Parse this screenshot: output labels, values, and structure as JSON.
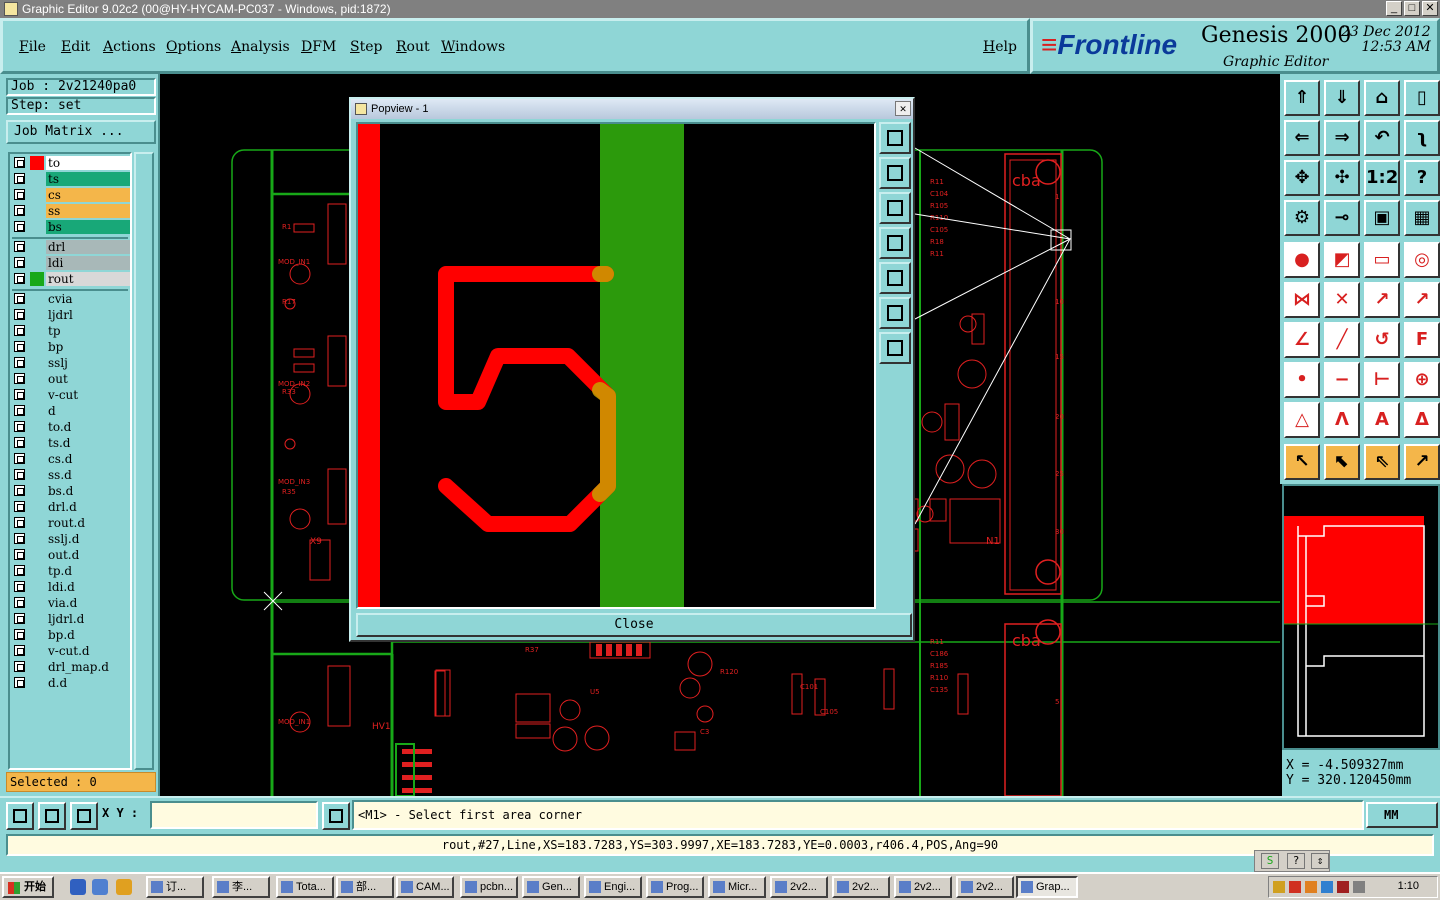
{
  "window": {
    "title": "Graphic Editor 9.02c2 (00@HY-HYCAM-PC037 - Windows, pid:1872)"
  },
  "menu": {
    "items": [
      "File",
      "Edit",
      "Actions",
      "Options",
      "Analysis",
      "DFM",
      "Step",
      "Rout",
      "Windows"
    ],
    "help": "Help"
  },
  "brand": {
    "logo": "Frontline",
    "product": "Genesis 2000",
    "subtitle": "Graphic Editor",
    "date": "23 Dec 2012",
    "time": "12:53 AM"
  },
  "job": {
    "job_label": "Job : 2v21240pa0",
    "step_label": "Step: set",
    "matrix_button": "Job Matrix ..."
  },
  "layers": [
    {
      "name": "to",
      "color": "#ff0000",
      "fill": "#ffffff"
    },
    {
      "name": "ts",
      "color": "",
      "fill": "#18a878"
    },
    {
      "name": "cs",
      "color": "",
      "fill": "#f4b64a"
    },
    {
      "name": "ss",
      "color": "",
      "fill": "#f4b64a"
    },
    {
      "name": "bs",
      "color": "",
      "fill": "#18a878"
    },
    {
      "name": "drl",
      "color": "",
      "fill": "#a8b8b8"
    },
    {
      "name": "ldi",
      "color": "",
      "fill": "#a8b8b8"
    },
    {
      "name": "rout",
      "color": "#18a818",
      "fill": "#d8d8d8"
    },
    {
      "name": "cvia",
      "color": "",
      "fill": "#8fd6d6"
    },
    {
      "name": "ljdrl",
      "color": "",
      "fill": "#8fd6d6"
    },
    {
      "name": "tp",
      "color": "",
      "fill": "#8fd6d6"
    },
    {
      "name": "bp",
      "color": "",
      "fill": "#8fd6d6"
    },
    {
      "name": "sslj",
      "color": "",
      "fill": "#8fd6d6"
    },
    {
      "name": "out",
      "color": "",
      "fill": "#8fd6d6"
    },
    {
      "name": "v-cut",
      "color": "",
      "fill": "#8fd6d6"
    },
    {
      "name": "d",
      "color": "",
      "fill": "#8fd6d6"
    },
    {
      "name": "to.d",
      "color": "",
      "fill": "#8fd6d6"
    },
    {
      "name": "ts.d",
      "color": "",
      "fill": "#8fd6d6"
    },
    {
      "name": "cs.d",
      "color": "",
      "fill": "#8fd6d6"
    },
    {
      "name": "ss.d",
      "color": "",
      "fill": "#8fd6d6"
    },
    {
      "name": "bs.d",
      "color": "",
      "fill": "#8fd6d6"
    },
    {
      "name": "drl.d",
      "color": "",
      "fill": "#8fd6d6"
    },
    {
      "name": "rout.d",
      "color": "",
      "fill": "#8fd6d6"
    },
    {
      "name": "sslj.d",
      "color": "",
      "fill": "#8fd6d6"
    },
    {
      "name": "out.d",
      "color": "",
      "fill": "#8fd6d6"
    },
    {
      "name": "tp.d",
      "color": "",
      "fill": "#8fd6d6"
    },
    {
      "name": "ldi.d",
      "color": "",
      "fill": "#8fd6d6"
    },
    {
      "name": "via.d",
      "color": "",
      "fill": "#8fd6d6"
    },
    {
      "name": "ljdrl.d",
      "color": "",
      "fill": "#8fd6d6"
    },
    {
      "name": "bp.d",
      "color": "",
      "fill": "#8fd6d6"
    },
    {
      "name": "v-cut.d",
      "color": "",
      "fill": "#8fd6d6"
    },
    {
      "name": "drl_map.d",
      "color": "",
      "fill": "#8fd6d6"
    },
    {
      "name": "d.d",
      "color": "",
      "fill": "#8fd6d6"
    }
  ],
  "selected": "Selected : 0",
  "popview": {
    "title": "Popview - 1",
    "close_label": "Close",
    "digit": "5"
  },
  "board_labels": [
    "cba",
    "cba",
    "N1",
    "X9",
    "HV1"
  ],
  "right_toolbar": {
    "rows": [
      [
        "home-up",
        "home-down",
        "house",
        "split"
      ],
      [
        "pan-left",
        "pan-right",
        "undo-view",
        "zigzag"
      ],
      [
        "fit",
        "center",
        "1:2",
        "?"
      ],
      [
        "tools",
        "measure",
        "layers-red",
        "layers-grid"
      ],
      [
        "pad",
        "cross-red",
        "ruler",
        "circle"
      ],
      [
        "node",
        "cross-blue",
        "snap-red",
        "snap-blue"
      ],
      [
        "angle",
        "line",
        "arc",
        "text-F"
      ],
      [
        "point",
        "minus",
        "dim",
        "move"
      ],
      [
        "triangle",
        "a-shape",
        "a-bar",
        "a-dash"
      ],
      [
        "pointer",
        "pointer-box",
        "pointer-dot",
        "pointer-step"
      ]
    ],
    "glyphs": {
      "1:2": "1:2",
      "?": "?"
    }
  },
  "coords": {
    "x": "X  =  -4.509327mm",
    "y": "Y  =  320.120450mm"
  },
  "command": {
    "xy_label": "X Y :",
    "prompt": "<M1> - Select first area corner",
    "units": "MM"
  },
  "status": "rout,#27,Line,XS=183.7283,YS=303.9997,XE=183.7283,YE=0.0003,r406.4,POS,Ang=90",
  "taskbar": {
    "start": "开始",
    "tasks": [
      "订...",
      "李...",
      "Tota...",
      "部...",
      "CAM...",
      "pcbn...",
      "Gen...",
      "Engi...",
      "Prog...",
      "Micr...",
      "2v2...",
      "2v2...",
      "2v2...",
      "2v2...",
      "Grap..."
    ],
    "clock": "1:10"
  }
}
